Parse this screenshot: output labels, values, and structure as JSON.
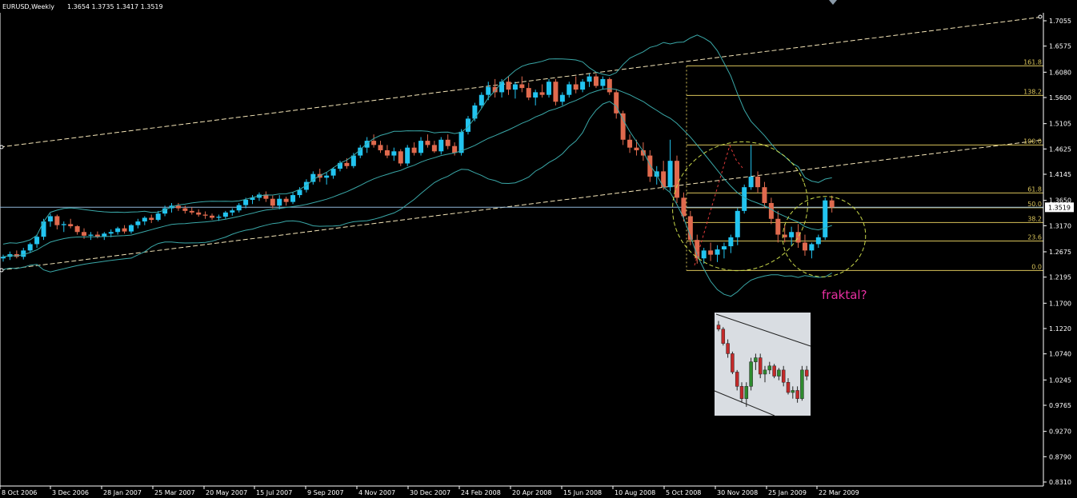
{
  "header": {
    "symbol": "EURUSD,Weekly",
    "ohlc": "1.3654 1.3735 1.3417 1.3519"
  },
  "annotation": "fraktal?",
  "current_price_label": "1.3519",
  "colors": {
    "background": "#000000",
    "bull": "#22c4f0",
    "bear": "#e06a4e",
    "bands": "#3aa8a8",
    "channel": "#f5e6b8",
    "fib": "#d8c35a",
    "annotation": "#e62fa0",
    "ellipse": "#c9d84a"
  },
  "chart_data": [
    {
      "type": "candlestick",
      "title": "EURUSD,Weekly",
      "y_axis_ticks": [
        "1.7055",
        "1.6575",
        "1.6080",
        "1.5600",
        "1.5105",
        "1.4625",
        "1.4145",
        "1.3650",
        "1.3170",
        "1.2675",
        "1.2195",
        "1.1700",
        "1.1220",
        "1.0740",
        "1.0245",
        "0.9765",
        "0.9270",
        "0.8790",
        "0.8310"
      ],
      "x_axis_ticks": [
        "8 Oct 2006",
        "3 Dec 2006",
        "28 Jan 2007",
        "25 Mar 2007",
        "20 May 2007",
        "15 Jul 2007",
        "9 Sep 2007",
        "4 Nov 2007",
        "30 Dec 2007",
        "24 Feb 2008",
        "20 Apr 2008",
        "15 Jun 2008",
        "10 Aug 2008",
        "5 Oct 2008",
        "30 Nov 2008",
        "25 Jan 2009",
        "22 Mar 2009"
      ],
      "ylim": [
        0.831,
        1.72
      ],
      "fibonacci_levels": [
        {
          "label": "161.8",
          "price": 1.62
        },
        {
          "label": "138.2",
          "price": 1.564
        },
        {
          "label": "100.0",
          "price": 1.47
        },
        {
          "label": "61.8",
          "price": 1.379
        },
        {
          "label": "50.0",
          "price": 1.351
        },
        {
          "label": "38.2",
          "price": 1.323
        },
        {
          "label": "23.6",
          "price": 1.288
        },
        {
          "label": "0.0",
          "price": 1.232
        }
      ],
      "last_price": 1.3519,
      "candles": [
        [
          1.255,
          1.262,
          1.249,
          1.258
        ],
        [
          1.258,
          1.268,
          1.252,
          1.263
        ],
        [
          1.263,
          1.27,
          1.255,
          1.258
        ],
        [
          1.258,
          1.275,
          1.253,
          1.27
        ],
        [
          1.27,
          1.285,
          1.265,
          1.282
        ],
        [
          1.282,
          1.3,
          1.275,
          1.296
        ],
        [
          1.296,
          1.33,
          1.29,
          1.325
        ],
        [
          1.325,
          1.34,
          1.315,
          1.335
        ],
        [
          1.335,
          1.338,
          1.31,
          1.318
        ],
        [
          1.318,
          1.325,
          1.305,
          1.32
        ],
        [
          1.32,
          1.33,
          1.312,
          1.316
        ],
        [
          1.316,
          1.318,
          1.3,
          1.305
        ],
        [
          1.305,
          1.312,
          1.292,
          1.298
        ],
        [
          1.298,
          1.305,
          1.29,
          1.3
        ],
        [
          1.3,
          1.306,
          1.293,
          1.296
        ],
        [
          1.296,
          1.305,
          1.29,
          1.302
        ],
        [
          1.302,
          1.31,
          1.295,
          1.305
        ],
        [
          1.305,
          1.315,
          1.3,
          1.312
        ],
        [
          1.312,
          1.318,
          1.302,
          1.306
        ],
        [
          1.306,
          1.32,
          1.302,
          1.318
        ],
        [
          1.318,
          1.33,
          1.312,
          1.325
        ],
        [
          1.325,
          1.335,
          1.318,
          1.332
        ],
        [
          1.332,
          1.338,
          1.322,
          1.328
        ],
        [
          1.328,
          1.345,
          1.325,
          1.34
        ],
        [
          1.34,
          1.355,
          1.335,
          1.35
        ],
        [
          1.35,
          1.36,
          1.342,
          1.355
        ],
        [
          1.355,
          1.36,
          1.345,
          1.35
        ],
        [
          1.35,
          1.355,
          1.34,
          1.345
        ],
        [
          1.345,
          1.352,
          1.338,
          1.342
        ],
        [
          1.342,
          1.348,
          1.334,
          1.338
        ],
        [
          1.338,
          1.344,
          1.33,
          1.336
        ],
        [
          1.336,
          1.34,
          1.328,
          1.332
        ],
        [
          1.332,
          1.338,
          1.326,
          1.334
        ],
        [
          1.334,
          1.345,
          1.33,
          1.342
        ],
        [
          1.342,
          1.35,
          1.336,
          1.346
        ],
        [
          1.346,
          1.36,
          1.342,
          1.356
        ],
        [
          1.356,
          1.37,
          1.35,
          1.366
        ],
        [
          1.366,
          1.375,
          1.358,
          1.37
        ],
        [
          1.37,
          1.38,
          1.364,
          1.376
        ],
        [
          1.376,
          1.382,
          1.362,
          1.368
        ],
        [
          1.368,
          1.374,
          1.35,
          1.355
        ],
        [
          1.355,
          1.375,
          1.348,
          1.368
        ],
        [
          1.368,
          1.372,
          1.355,
          1.362
        ],
        [
          1.362,
          1.38,
          1.358,
          1.375
        ],
        [
          1.375,
          1.39,
          1.37,
          1.385
        ],
        [
          1.385,
          1.405,
          1.38,
          1.4
        ],
        [
          1.4,
          1.42,
          1.395,
          1.415
        ],
        [
          1.415,
          1.425,
          1.4,
          1.408
        ],
        [
          1.408,
          1.418,
          1.395,
          1.412
        ],
        [
          1.412,
          1.428,
          1.406,
          1.425
        ],
        [
          1.425,
          1.44,
          1.42,
          1.436
        ],
        [
          1.436,
          1.445,
          1.425,
          1.43
        ],
        [
          1.43,
          1.455,
          1.426,
          1.45
        ],
        [
          1.45,
          1.47,
          1.445,
          1.465
        ],
        [
          1.465,
          1.485,
          1.455,
          1.478
        ],
        [
          1.478,
          1.49,
          1.465,
          1.47
        ],
        [
          1.47,
          1.478,
          1.455,
          1.46
        ],
        [
          1.46,
          1.47,
          1.445,
          1.45
        ],
        [
          1.45,
          1.465,
          1.44,
          1.458
        ],
        [
          1.458,
          1.462,
          1.43,
          1.435
        ],
        [
          1.435,
          1.47,
          1.43,
          1.465
        ],
        [
          1.465,
          1.475,
          1.45,
          1.455
        ],
        [
          1.455,
          1.485,
          1.45,
          1.478
        ],
        [
          1.478,
          1.49,
          1.465,
          1.47
        ],
        [
          1.47,
          1.478,
          1.455,
          1.458
        ],
        [
          1.458,
          1.485,
          1.452,
          1.48
        ],
        [
          1.48,
          1.49,
          1.462,
          1.468
        ],
        [
          1.468,
          1.475,
          1.45,
          1.455
        ],
        [
          1.455,
          1.5,
          1.45,
          1.495
        ],
        [
          1.495,
          1.525,
          1.49,
          1.52
        ],
        [
          1.52,
          1.55,
          1.515,
          1.545
        ],
        [
          1.545,
          1.57,
          1.54,
          1.565
        ],
        [
          1.565,
          1.59,
          1.555,
          1.58
        ],
        [
          1.58,
          1.595,
          1.56,
          1.57
        ],
        [
          1.57,
          1.595,
          1.56,
          1.59
        ],
        [
          1.59,
          1.6,
          1.565,
          1.575
        ],
        [
          1.575,
          1.59,
          1.558,
          1.585
        ],
        [
          1.585,
          1.6,
          1.57,
          1.578
        ],
        [
          1.578,
          1.588,
          1.555,
          1.56
        ],
        [
          1.56,
          1.575,
          1.545,
          1.57
        ],
        [
          1.57,
          1.585,
          1.56,
          1.565
        ],
        [
          1.565,
          1.595,
          1.56,
          1.59
        ],
        [
          1.59,
          1.595,
          1.545,
          1.552
        ],
        [
          1.552,
          1.57,
          1.545,
          1.565
        ],
        [
          1.565,
          1.59,
          1.56,
          1.585
        ],
        [
          1.585,
          1.6,
          1.568,
          1.575
        ],
        [
          1.575,
          1.595,
          1.57,
          1.59
        ],
        [
          1.59,
          1.605,
          1.58,
          1.6
        ],
        [
          1.6,
          1.605,
          1.578,
          1.582
        ],
        [
          1.582,
          1.6,
          1.575,
          1.595
        ],
        [
          1.595,
          1.598,
          1.565,
          1.57
        ],
        [
          1.57,
          1.575,
          1.52,
          1.53
        ],
        [
          1.53,
          1.535,
          1.47,
          1.48
        ],
        [
          1.48,
          1.49,
          1.455,
          1.465
        ],
        [
          1.465,
          1.48,
          1.45,
          1.46
        ],
        [
          1.46,
          1.475,
          1.44,
          1.45
        ],
        [
          1.45,
          1.46,
          1.4,
          1.41
        ],
        [
          1.41,
          1.43,
          1.395,
          1.42
        ],
        [
          1.42,
          1.44,
          1.385,
          1.39
        ],
        [
          1.39,
          1.48,
          1.382,
          1.44
        ],
        [
          1.44,
          1.45,
          1.36,
          1.37
        ],
        [
          1.37,
          1.38,
          1.325,
          1.335
        ],
        [
          1.335,
          1.345,
          1.28,
          1.29
        ],
        [
          1.29,
          1.3,
          1.245,
          1.255
        ],
        [
          1.255,
          1.275,
          1.245,
          1.27
        ],
        [
          1.27,
          1.285,
          1.25,
          1.262
        ],
        [
          1.262,
          1.28,
          1.248,
          1.272
        ],
        [
          1.272,
          1.285,
          1.255,
          1.278
        ],
        [
          1.278,
          1.3,
          1.265,
          1.295
        ],
        [
          1.295,
          1.35,
          1.28,
          1.345
        ],
        [
          1.345,
          1.395,
          1.34,
          1.39
        ],
        [
          1.39,
          1.47,
          1.385,
          1.41
        ],
        [
          1.41,
          1.42,
          1.38,
          1.39
        ],
        [
          1.39,
          1.4,
          1.35,
          1.36
        ],
        [
          1.36,
          1.37,
          1.32,
          1.33
        ],
        [
          1.33,
          1.345,
          1.285,
          1.3
        ],
        [
          1.3,
          1.32,
          1.285,
          1.295
        ],
        [
          1.295,
          1.315,
          1.28,
          1.305
        ],
        [
          1.305,
          1.32,
          1.275,
          1.285
        ],
        [
          1.285,
          1.3,
          1.26,
          1.27
        ],
        [
          1.27,
          1.285,
          1.255,
          1.282
        ],
        [
          1.282,
          1.3,
          1.275,
          1.295
        ],
        [
          1.295,
          1.37,
          1.29,
          1.365
        ],
        [
          1.365,
          1.374,
          1.342,
          1.352
        ]
      ]
    },
    {
      "type": "candlestick",
      "title": "",
      "candles": [
        [
          1.0,
          1.02,
          0.97,
          0.98
        ],
        [
          0.98,
          0.99,
          0.9,
          0.91
        ],
        [
          0.91,
          0.93,
          0.84,
          0.86
        ],
        [
          0.86,
          0.87,
          0.76,
          0.77
        ],
        [
          0.77,
          0.78,
          0.68,
          0.7
        ],
        [
          0.7,
          0.72,
          0.62,
          0.64
        ],
        [
          0.64,
          0.72,
          0.6,
          0.7
        ],
        [
          0.7,
          0.84,
          0.68,
          0.82
        ],
        [
          0.82,
          0.86,
          0.78,
          0.84
        ],
        [
          0.84,
          0.86,
          0.74,
          0.76
        ],
        [
          0.76,
          0.8,
          0.72,
          0.78
        ],
        [
          0.78,
          0.82,
          0.76,
          0.8
        ],
        [
          0.8,
          0.81,
          0.74,
          0.75
        ],
        [
          0.75,
          0.79,
          0.73,
          0.78
        ],
        [
          0.78,
          0.8,
          0.7,
          0.72
        ],
        [
          0.72,
          0.74,
          0.66,
          0.67
        ],
        [
          0.67,
          0.7,
          0.64,
          0.68
        ],
        [
          0.68,
          0.7,
          0.62,
          0.64
        ],
        [
          0.64,
          0.8,
          0.63,
          0.78
        ],
        [
          0.78,
          0.8,
          0.73,
          0.75
        ]
      ]
    }
  ]
}
